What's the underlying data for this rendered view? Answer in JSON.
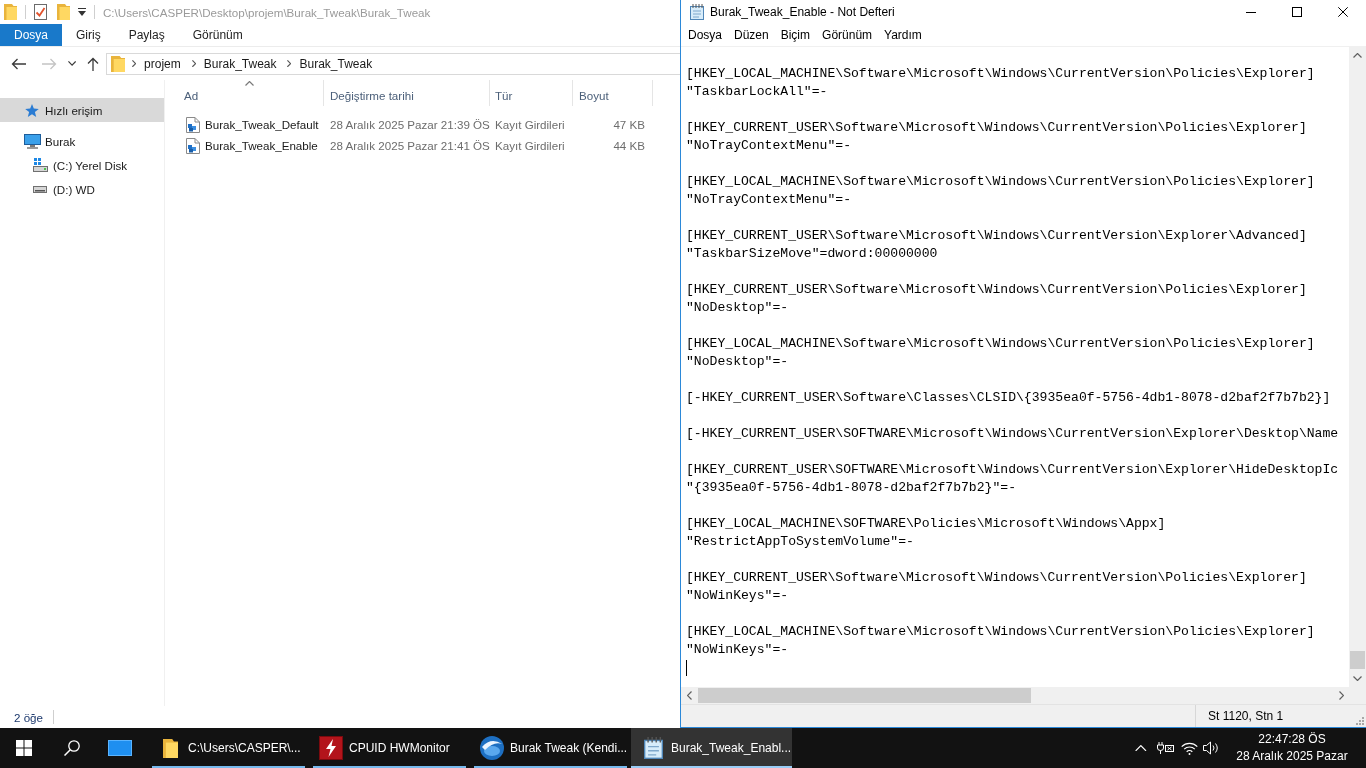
{
  "explorer": {
    "title": "C:\\Users\\CASPER\\Desktop\\projem\\Burak_Tweak\\Burak_Tweak",
    "ribbon": {
      "file_button": "Dosya",
      "tabs": [
        "Giriş",
        "Paylaş",
        "Görünüm"
      ]
    },
    "nav_buttons": [
      {
        "kind": "back",
        "disabled": false
      },
      {
        "kind": "forward",
        "disabled": true
      },
      {
        "kind": "recent",
        "disabled": false
      },
      {
        "kind": "up",
        "disabled": false
      }
    ],
    "breadcrumb": [
      "projem",
      "Burak_Tweak",
      "Burak_Tweak"
    ],
    "sidebar": {
      "items": [
        {
          "label": "Hızlı erişim",
          "kind": "quick-access",
          "selected": true
        },
        {
          "label": "Burak",
          "kind": "computer",
          "selected": false,
          "children": [
            {
              "label": "(C:) Yerel Disk",
              "kind": "system-drive",
              "selected": false
            },
            {
              "label": "(D:) WD",
              "kind": "drive",
              "selected": false
            }
          ]
        }
      ]
    },
    "table": {
      "columns": [
        {
          "label": "Ad",
          "sorted": true
        },
        {
          "label": "Değiştirme tarihi",
          "sorted": false
        },
        {
          "label": "Tür",
          "sorted": false
        },
        {
          "label": "Boyut",
          "sorted": false
        }
      ],
      "rows": [
        {
          "name": "Burak_Tweak_Default",
          "modified": "28 Aralık 2025 Pazar 21:39 ÖS",
          "type": "Kayıt Girdileri",
          "size": "47 KB"
        },
        {
          "name": "Burak_Tweak_Enable",
          "modified": "28 Aralık 2025 Pazar 21:41 ÖS",
          "type": "Kayıt Girdileri",
          "size": "44 KB"
        }
      ]
    },
    "status_bar": "2 öğe"
  },
  "notepad": {
    "title": "Burak_Tweak_Enable - Not Defteri",
    "menu": [
      "Dosya",
      "Düzen",
      "Biçim",
      "Görünüm",
      "Yardım"
    ],
    "blocks": [
      {
        "lines": [
          "[HKEY_LOCAL_MACHINE\\Software\\Microsoft\\Windows\\CurrentVersion\\Policies\\Explorer]",
          "\"TaskbarLockAll\"=-"
        ]
      },
      {
        "lines": [
          "[HKEY_CURRENT_USER\\Software\\Microsoft\\Windows\\CurrentVersion\\Policies\\Explorer]",
          "\"NoTrayContextMenu\"=-"
        ]
      },
      {
        "lines": [
          "[HKEY_LOCAL_MACHINE\\Software\\Microsoft\\Windows\\CurrentVersion\\Policies\\Explorer]",
          "\"NoTrayContextMenu\"=-"
        ]
      },
      {
        "lines": [
          "[HKEY_CURRENT_USER\\Software\\Microsoft\\Windows\\CurrentVersion\\Explorer\\Advanced]",
          "\"TaskbarSizeMove\"=dword:00000000"
        ]
      },
      {
        "lines": [
          "[HKEY_CURRENT_USER\\Software\\Microsoft\\Windows\\CurrentVersion\\Policies\\Explorer]",
          "\"NoDesktop\"=-"
        ]
      },
      {
        "lines": [
          "[HKEY_LOCAL_MACHINE\\Software\\Microsoft\\Windows\\CurrentVersion\\Policies\\Explorer]",
          "\"NoDesktop\"=-"
        ]
      },
      {
        "lines": [
          "[-HKEY_CURRENT_USER\\Software\\Classes\\CLSID\\{3935ea0f-5756-4db1-8078-d2baf2f7b7b2}]"
        ]
      },
      {
        "lines": [
          "[-HKEY_CURRENT_USER\\SOFTWARE\\Microsoft\\Windows\\CurrentVersion\\Explorer\\Desktop\\Name"
        ]
      },
      {
        "lines": [
          "[HKEY_CURRENT_USER\\SOFTWARE\\Microsoft\\Windows\\CurrentVersion\\Explorer\\HideDesktopIc",
          "\"{3935ea0f-5756-4db1-8078-d2baf2f7b7b2}\"=-"
        ]
      },
      {
        "lines": [
          "[HKEY_LOCAL_MACHINE\\SOFTWARE\\Policies\\Microsoft\\Windows\\Appx]",
          "\"RestrictAppToSystemVolume\"=-"
        ]
      },
      {
        "lines": [
          "[HKEY_CURRENT_USER\\Software\\Microsoft\\Windows\\CurrentVersion\\Policies\\Explorer]",
          "\"NoWinKeys\"=-"
        ]
      },
      {
        "lines": [
          "[HKEY_LOCAL_MACHINE\\Software\\Microsoft\\Windows\\CurrentVersion\\Policies\\Explorer]",
          "\"NoWinKeys\"=-"
        ]
      }
    ],
    "status_bar": "St 1120, Stn 1"
  },
  "taskbar": {
    "items": [
      {
        "label": "C:\\Users\\CASPER\\...",
        "kind": "folder",
        "selected": false
      },
      {
        "label": "CPUID HWMonitor",
        "kind": "lightning",
        "selected": false
      },
      {
        "label": "Burak Tweak (Kendi...",
        "kind": "globe",
        "selected": false
      },
      {
        "label": "Burak_Tweak_Enabl...",
        "kind": "notepad",
        "selected": true
      }
    ],
    "clock": {
      "time": "22:47:28 ÖS",
      "date": "28 Aralık 2025 Pazar"
    }
  }
}
